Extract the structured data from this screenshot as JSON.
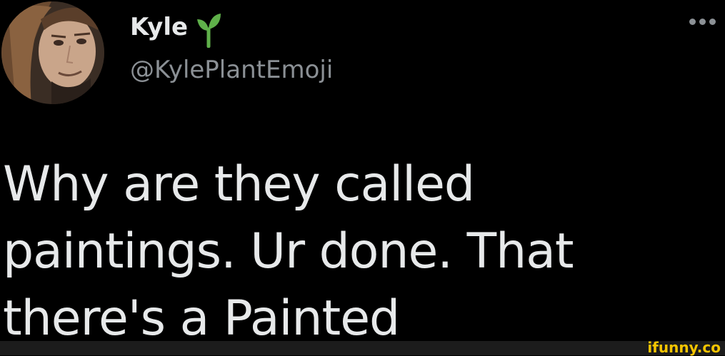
{
  "tweet": {
    "display_name": "Kyle",
    "handle": "@KylePlantEmoji",
    "badge_icon": "sprout-icon",
    "more_icon": "more-options-icon",
    "text": "Why are they called\npaintings. Ur done. That\nthere's a Painted"
  },
  "watermark": {
    "text": "ifunny.co"
  },
  "colors": {
    "background": "#000000",
    "text_primary": "#e7e9ea",
    "text_secondary": "#8b9095",
    "sprout": "#5fb04a",
    "watermark": "#f5c400"
  }
}
